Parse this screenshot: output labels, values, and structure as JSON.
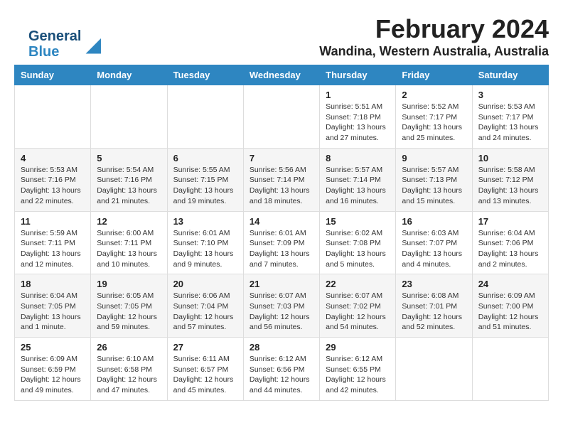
{
  "logo": {
    "line1": "General",
    "line2": "Blue"
  },
  "title": "February 2024",
  "subtitle": "Wandina, Western Australia, Australia",
  "days_of_week": [
    "Sunday",
    "Monday",
    "Tuesday",
    "Wednesday",
    "Thursday",
    "Friday",
    "Saturday"
  ],
  "weeks": [
    [
      {
        "day": "",
        "info": ""
      },
      {
        "day": "",
        "info": ""
      },
      {
        "day": "",
        "info": ""
      },
      {
        "day": "",
        "info": ""
      },
      {
        "day": "1",
        "info": "Sunrise: 5:51 AM\nSunset: 7:18 PM\nDaylight: 13 hours\nand 27 minutes."
      },
      {
        "day": "2",
        "info": "Sunrise: 5:52 AM\nSunset: 7:17 PM\nDaylight: 13 hours\nand 25 minutes."
      },
      {
        "day": "3",
        "info": "Sunrise: 5:53 AM\nSunset: 7:17 PM\nDaylight: 13 hours\nand 24 minutes."
      }
    ],
    [
      {
        "day": "4",
        "info": "Sunrise: 5:53 AM\nSunset: 7:16 PM\nDaylight: 13 hours\nand 22 minutes."
      },
      {
        "day": "5",
        "info": "Sunrise: 5:54 AM\nSunset: 7:16 PM\nDaylight: 13 hours\nand 21 minutes."
      },
      {
        "day": "6",
        "info": "Sunrise: 5:55 AM\nSunset: 7:15 PM\nDaylight: 13 hours\nand 19 minutes."
      },
      {
        "day": "7",
        "info": "Sunrise: 5:56 AM\nSunset: 7:14 PM\nDaylight: 13 hours\nand 18 minutes."
      },
      {
        "day": "8",
        "info": "Sunrise: 5:57 AM\nSunset: 7:14 PM\nDaylight: 13 hours\nand 16 minutes."
      },
      {
        "day": "9",
        "info": "Sunrise: 5:57 AM\nSunset: 7:13 PM\nDaylight: 13 hours\nand 15 minutes."
      },
      {
        "day": "10",
        "info": "Sunrise: 5:58 AM\nSunset: 7:12 PM\nDaylight: 13 hours\nand 13 minutes."
      }
    ],
    [
      {
        "day": "11",
        "info": "Sunrise: 5:59 AM\nSunset: 7:11 PM\nDaylight: 13 hours\nand 12 minutes."
      },
      {
        "day": "12",
        "info": "Sunrise: 6:00 AM\nSunset: 7:11 PM\nDaylight: 13 hours\nand 10 minutes."
      },
      {
        "day": "13",
        "info": "Sunrise: 6:01 AM\nSunset: 7:10 PM\nDaylight: 13 hours\nand 9 minutes."
      },
      {
        "day": "14",
        "info": "Sunrise: 6:01 AM\nSunset: 7:09 PM\nDaylight: 13 hours\nand 7 minutes."
      },
      {
        "day": "15",
        "info": "Sunrise: 6:02 AM\nSunset: 7:08 PM\nDaylight: 13 hours\nand 5 minutes."
      },
      {
        "day": "16",
        "info": "Sunrise: 6:03 AM\nSunset: 7:07 PM\nDaylight: 13 hours\nand 4 minutes."
      },
      {
        "day": "17",
        "info": "Sunrise: 6:04 AM\nSunset: 7:06 PM\nDaylight: 13 hours\nand 2 minutes."
      }
    ],
    [
      {
        "day": "18",
        "info": "Sunrise: 6:04 AM\nSunset: 7:05 PM\nDaylight: 13 hours\nand 1 minute."
      },
      {
        "day": "19",
        "info": "Sunrise: 6:05 AM\nSunset: 7:05 PM\nDaylight: 12 hours\nand 59 minutes."
      },
      {
        "day": "20",
        "info": "Sunrise: 6:06 AM\nSunset: 7:04 PM\nDaylight: 12 hours\nand 57 minutes."
      },
      {
        "day": "21",
        "info": "Sunrise: 6:07 AM\nSunset: 7:03 PM\nDaylight: 12 hours\nand 56 minutes."
      },
      {
        "day": "22",
        "info": "Sunrise: 6:07 AM\nSunset: 7:02 PM\nDaylight: 12 hours\nand 54 minutes."
      },
      {
        "day": "23",
        "info": "Sunrise: 6:08 AM\nSunset: 7:01 PM\nDaylight: 12 hours\nand 52 minutes."
      },
      {
        "day": "24",
        "info": "Sunrise: 6:09 AM\nSunset: 7:00 PM\nDaylight: 12 hours\nand 51 minutes."
      }
    ],
    [
      {
        "day": "25",
        "info": "Sunrise: 6:09 AM\nSunset: 6:59 PM\nDaylight: 12 hours\nand 49 minutes."
      },
      {
        "day": "26",
        "info": "Sunrise: 6:10 AM\nSunset: 6:58 PM\nDaylight: 12 hours\nand 47 minutes."
      },
      {
        "day": "27",
        "info": "Sunrise: 6:11 AM\nSunset: 6:57 PM\nDaylight: 12 hours\nand 45 minutes."
      },
      {
        "day": "28",
        "info": "Sunrise: 6:12 AM\nSunset: 6:56 PM\nDaylight: 12 hours\nand 44 minutes."
      },
      {
        "day": "29",
        "info": "Sunrise: 6:12 AM\nSunset: 6:55 PM\nDaylight: 12 hours\nand 42 minutes."
      },
      {
        "day": "",
        "info": ""
      },
      {
        "day": "",
        "info": ""
      }
    ]
  ]
}
